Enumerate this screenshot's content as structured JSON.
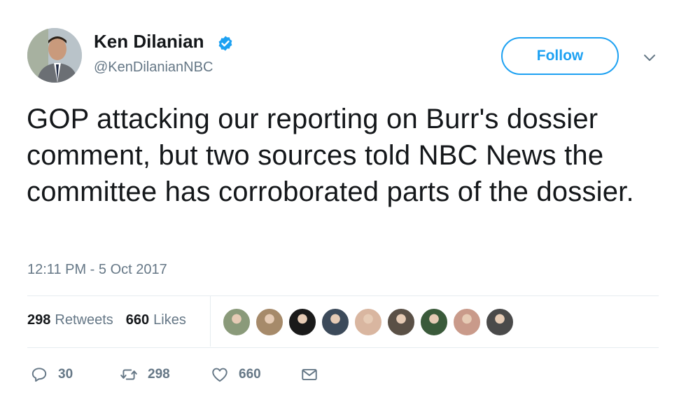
{
  "user": {
    "name": "Ken Dilanian",
    "handle": "@KenDilanianNBC",
    "verified": true
  },
  "follow_label": "Follow",
  "tweet": {
    "text": "GOP attacking our reporting on Burr's dossier comment, but two sources told NBC News the committee has corroborated parts of the dossier.",
    "timestamp": "12:11 PM - 5 Oct 2017"
  },
  "stats": {
    "retweets_count": "298",
    "retweets_label": "Retweets",
    "likes_count": "660",
    "likes_label": "Likes"
  },
  "likers": [
    {
      "color": "#8a9a7a"
    },
    {
      "color": "#a68a6a"
    },
    {
      "color": "#1a1a1a"
    },
    {
      "color": "#3c4a5a"
    },
    {
      "color": "#d9b6a0"
    },
    {
      "color": "#5a5046"
    },
    {
      "color": "#3a5a3a"
    },
    {
      "color": "#c99a8a"
    },
    {
      "color": "#4a4a4a"
    }
  ],
  "actions": {
    "replies": "30",
    "retweets": "298",
    "likes": "660"
  },
  "colors": {
    "accent": "#1da1f2",
    "secondary_text": "#657786",
    "primary_text": "#14171a"
  }
}
